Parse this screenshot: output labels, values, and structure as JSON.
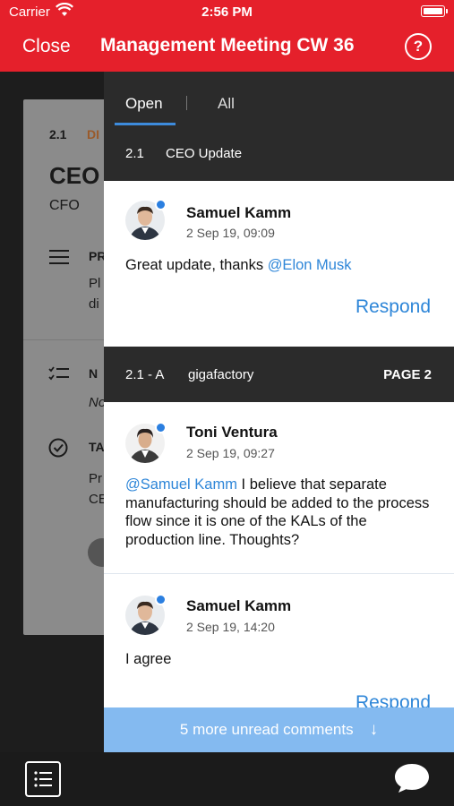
{
  "status": {
    "carrier": "Carrier",
    "time": "2:56 PM"
  },
  "nav": {
    "close_label": "Close",
    "title": "Management Meeting CW 36",
    "help_label": "?"
  },
  "background_card": {
    "number": "2.1",
    "tag": "DI",
    "heading": "CEO",
    "role": "CFO",
    "row1_label": "PR",
    "row1_text_a": "Pl",
    "row1_text_b": "di",
    "row2_label": "N",
    "row2_text": "No",
    "row3_label": "TA",
    "row3_text_a": "Pr",
    "row3_text_b": "CE"
  },
  "tabs": {
    "open": "Open",
    "all": "All"
  },
  "sections": [
    {
      "number": "2.1",
      "title": "CEO Update",
      "page": ""
    },
    {
      "number": "2.1 - A",
      "title": "gigafactory",
      "page": "PAGE 2"
    }
  ],
  "comments": [
    {
      "author": "Samuel Kamm",
      "date": "2 Sep 19, 09:09",
      "text_before": "Great update, thanks ",
      "mention": "@Elon Musk",
      "text_after": ""
    },
    {
      "author": "Toni Ventura",
      "date": "2 Sep 19, 09:27",
      "text_before": "",
      "mention": "@Samuel Kamm",
      "text_after": " I believe that separate manufacturing should be added to the process flow since it is one of the KALs of the production line. Thoughts?"
    },
    {
      "author": "Samuel Kamm",
      "date": "2 Sep 19, 14:20",
      "text_before": "I agree",
      "mention": "",
      "text_after": ""
    }
  ],
  "respond_label": "Respond",
  "unread_banner": {
    "text": "5 more unread comments",
    "icon": "arrow-down-icon"
  },
  "toolbar": {
    "list_icon": "list-icon",
    "chat_icon": "chat-bubble-icon"
  },
  "colors": {
    "brand_red": "#e5202b",
    "accent_blue": "#2e86d8",
    "unread_bg": "#84baf0",
    "dark": "#2b2b2b"
  }
}
